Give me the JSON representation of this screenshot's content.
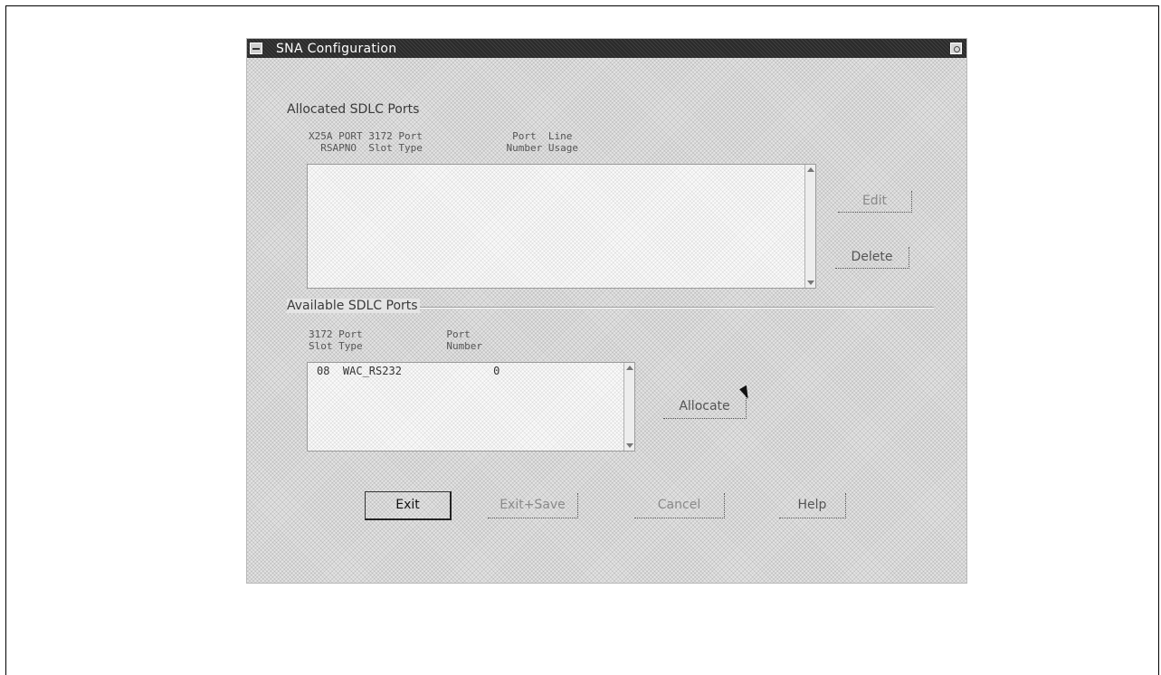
{
  "window": {
    "title": "SNA Configuration",
    "icons": {
      "system_menu": "system-menu-icon",
      "minimize": "minimize-icon"
    }
  },
  "allocated": {
    "label": "Allocated SDLC Ports",
    "header_line1": "X25A PORT 3172 Port               Port  Line",
    "header_line2": "  RSAPNO  Slot Type              Number Usage",
    "rows": []
  },
  "available": {
    "label": "Available SDLC Ports",
    "header_line1": "3172 Port              Port",
    "header_line2": "Slot Type              Number",
    "rows": [
      {
        "text": "08  WAC_RS232              0"
      }
    ]
  },
  "buttons": {
    "edit": "Edit",
    "delete": "Delete",
    "allocate": "Allocate",
    "exit": "Exit",
    "exit_save": "Exit+Save",
    "cancel": "Cancel",
    "help": "Help"
  }
}
